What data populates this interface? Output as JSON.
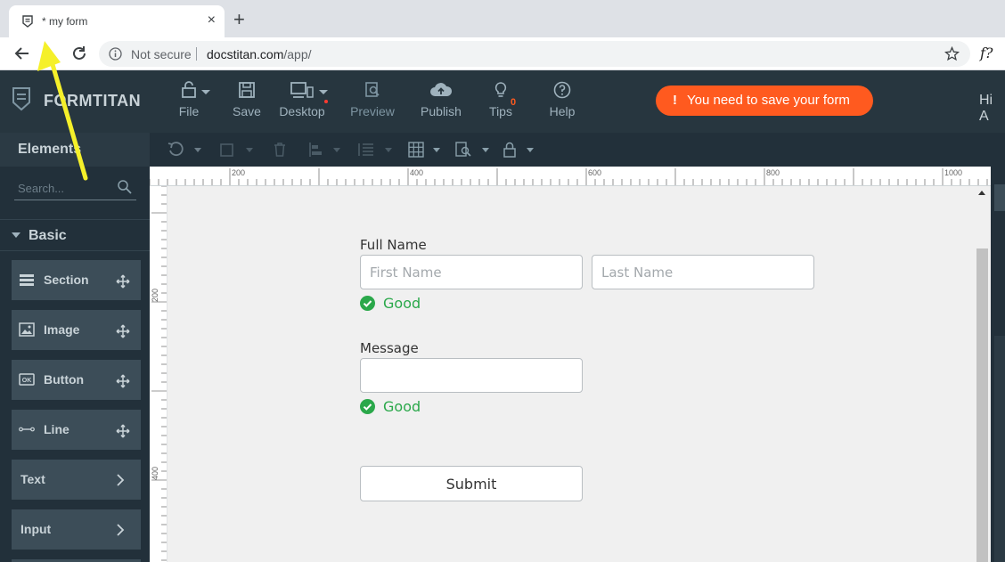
{
  "browser": {
    "tab_title": "* my form",
    "tab_close": "×",
    "new_tab": "+",
    "security_label": "Not secure",
    "url_host": "docstitan.com",
    "url_path": "/app/",
    "extension_label": "f?"
  },
  "app": {
    "brand": "FORMTITAN",
    "menu": [
      {
        "label": "File"
      },
      {
        "label": "Save"
      },
      {
        "label": "Desktop"
      },
      {
        "label": "Preview"
      },
      {
        "label": "Publish"
      },
      {
        "label": "Tips",
        "badge": "0"
      },
      {
        "label": "Help"
      }
    ],
    "alert": {
      "icon": "!",
      "message": "You need to save your form"
    },
    "greeting": "Hi A"
  },
  "sidebar": {
    "title": "Elements",
    "search_placeholder": "Search...",
    "category": "Basic",
    "items": [
      {
        "label": "Section",
        "icon": "section-icon"
      },
      {
        "label": "Image",
        "icon": "image-icon"
      },
      {
        "label": "Button",
        "icon": "button-icon"
      },
      {
        "label": "Line",
        "icon": "line-icon"
      },
      {
        "label": "Text"
      },
      {
        "label": "Input"
      }
    ]
  },
  "ruler": {
    "h_ticks": [
      "200",
      "400",
      "600",
      "800",
      "1000"
    ],
    "v_ticks": [
      "200",
      "400"
    ]
  },
  "form": {
    "full_name_label": "Full Name",
    "first_name_placeholder": "First Name",
    "last_name_placeholder": "Last Name",
    "name_status": "Good",
    "message_label": "Message",
    "message_value": "",
    "message_status": "Good",
    "submit_label": "Submit"
  },
  "colors": {
    "header_bg": "#27363f",
    "alert_bg": "#ff5a1f",
    "good_green": "#2aa84a",
    "annotation_arrow": "#f5f02a"
  }
}
